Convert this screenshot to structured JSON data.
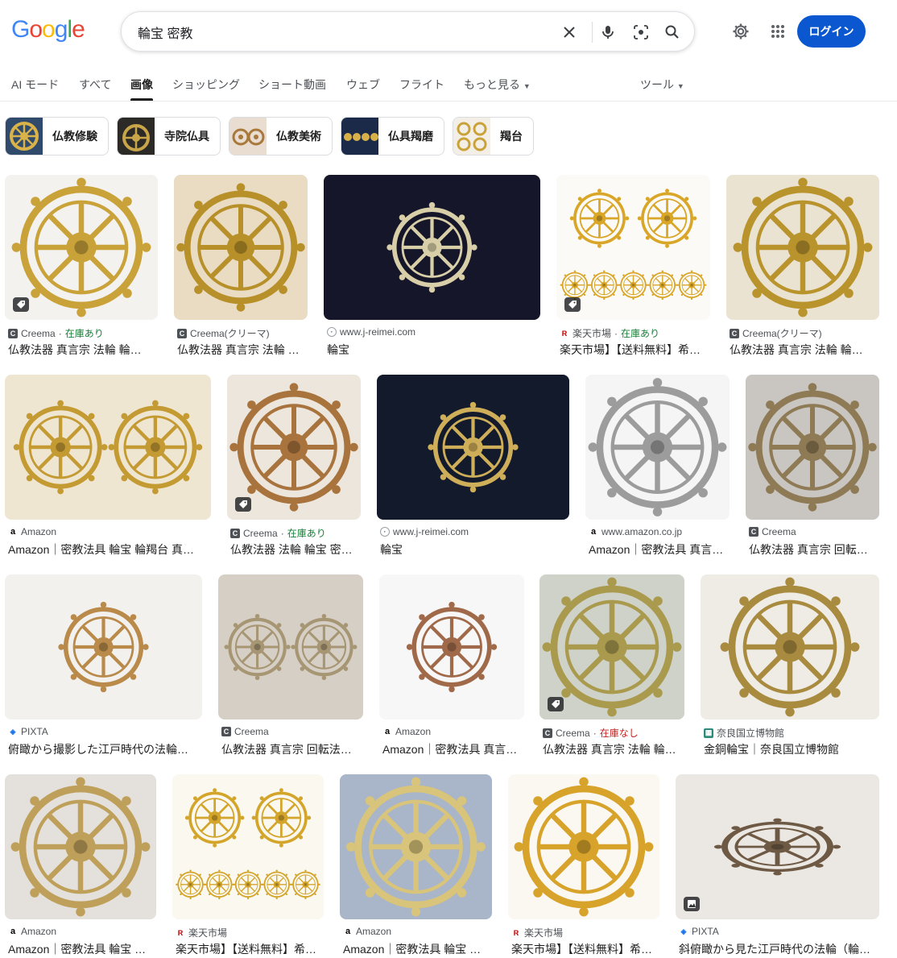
{
  "query": "輪宝 密教",
  "login_label": "ログイン",
  "tabs": [
    "AI モード",
    "すべて",
    "画像",
    "ショッピング",
    "ショート動画",
    "ウェブ",
    "フライト",
    "もっと見る",
    "ツール"
  ],
  "chips": [
    "仏教修験",
    "寺院仏具",
    "仏教美術",
    "仏具羯磨",
    "羯台"
  ],
  "colors": {
    "brand_blue": "#0b57d0",
    "gold": "#c9a23a",
    "stock_green": "#188038",
    "stock_red": "#c5221f"
  },
  "results": [
    {
      "source": "Creema",
      "stock": "在庫あり",
      "title": "仏教法器 真言宗 法輪 輪…"
    },
    {
      "source": "Creema(クリーマ)",
      "stock": "",
      "title": "仏教法器 真言宗 法輪 …"
    },
    {
      "source": "www.j-reimei.com",
      "stock": "",
      "title": "輪宝"
    },
    {
      "source": "楽天市場",
      "stock": "在庫あり",
      "title": "楽天市場】【送料無料】希…"
    },
    {
      "source": "Creema(クリーマ)",
      "stock": "",
      "title": "仏教法器 真言宗 法輪 輪…"
    },
    {
      "source": "Amazon",
      "stock": "",
      "title": "Amazon｜密教法具 輪宝 輪羯台 真…"
    },
    {
      "source": "Creema",
      "stock": "在庫あり",
      "title": "仏教法器 法輪 輪宝 密…"
    },
    {
      "source": "www.j-reimei.com",
      "stock": "",
      "title": "輪宝"
    },
    {
      "source": "www.amazon.co.jp",
      "stock": "",
      "title": "Amazon｜密教法具 真言…"
    },
    {
      "source": "Creema",
      "stock": "",
      "title": "仏教法器 真言宗 回転…"
    },
    {
      "source": "PIXTA",
      "stock": "",
      "title": "俯瞰から撮影した江戸時代の法輪…"
    },
    {
      "source": "Creema",
      "stock": "",
      "title": "仏教法器 真言宗 回転法…"
    },
    {
      "source": "Amazon",
      "stock": "",
      "title": "Amazon｜密教法具 真言…"
    },
    {
      "source": "Creema",
      "stock": "在庫なし",
      "title": "仏教法器 真言宗 法輪 輪…"
    },
    {
      "source": "奈良国立博物館",
      "stock": "",
      "title": "金銅輪宝｜奈良国立博物館"
    },
    {
      "source": "Amazon",
      "stock": "",
      "title": "Amazon｜密教法具 輪宝 …"
    },
    {
      "source": "楽天市場",
      "stock": "",
      "title": "楽天市場】【送料無料】希…"
    },
    {
      "source": "Amazon",
      "stock": "",
      "title": "Amazon｜密教法具 輪宝 …"
    },
    {
      "source": "楽天市場",
      "stock": "",
      "title": "楽天市場】【送料無料】希…"
    },
    {
      "source": "PIXTA",
      "stock": "",
      "title": "斜俯瞰から見た江戸時代の法輪（輪…"
    }
  ]
}
